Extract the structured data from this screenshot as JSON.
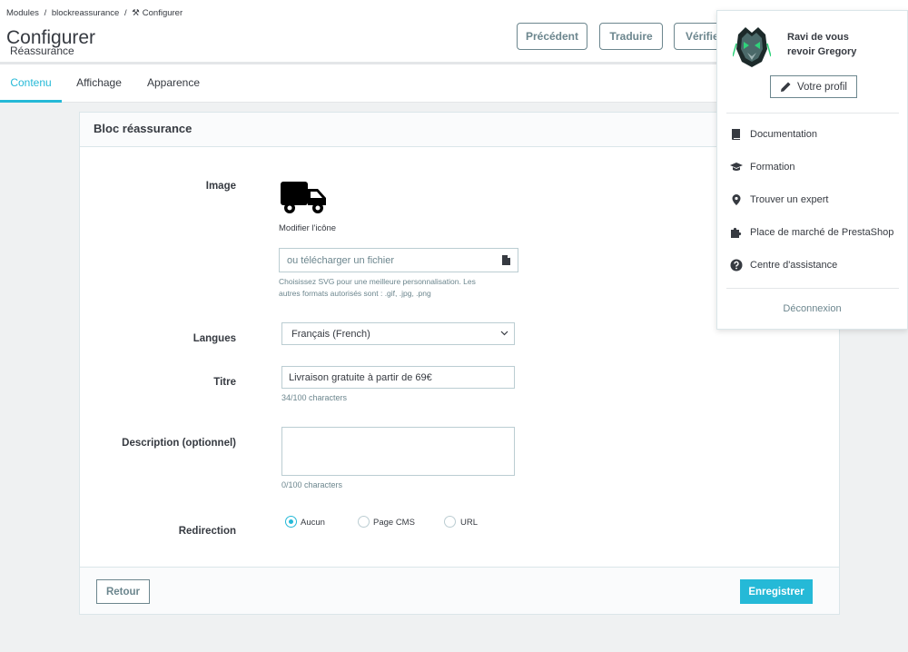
{
  "breadcrumb": [
    "Modules",
    "/",
    "blockreassurance",
    "/",
    "Configurer"
  ],
  "header": {
    "title": "Configurer",
    "subtitle": "Réassurance",
    "buttons": {
      "previous": "Précédent",
      "translate": "Traduire",
      "check": "Vérifie"
    }
  },
  "tabs": [
    "Contenu",
    "Affichage",
    "Apparence"
  ],
  "card": {
    "title": "Bloc réassurance",
    "labels": {
      "image": "Image",
      "languages": "Langues",
      "title": "Titre",
      "description": "Description (optionnel)",
      "redirection": "Redirection"
    },
    "image": {
      "icon": "truck-icon",
      "caption": "Modifier l'icône",
      "upload_placeholder": "ou télécharger un fichier",
      "help_line1": "Choisissez SVG pour une meilleure personnalisation. Les",
      "help_line2": "autres formats autorisés sont : .gif, .jpg, .png"
    },
    "language_value": "Français (French)",
    "title_value": "Livraison gratuite à partir de 69€",
    "title_counter": "34/100 characters",
    "description_value": "",
    "description_counter": "0/100 characters",
    "redirection": {
      "options": [
        "Aucun",
        "Page CMS",
        "URL"
      ],
      "selected": "Aucun"
    },
    "footer": {
      "back": "Retour",
      "save": "Enregistrer"
    }
  },
  "profile": {
    "greeting_line1": "Ravi de vous",
    "greeting_line2": "revoir Gregory",
    "edit_button": "Votre profil",
    "items": [
      {
        "label": "Documentation",
        "icon": "book-icon"
      },
      {
        "label": "Formation",
        "icon": "graduation-cap-icon"
      },
      {
        "label": "Trouver un expert",
        "icon": "location-pin-icon"
      },
      {
        "label": "Place de marché de PrestaShop",
        "icon": "puzzle-icon"
      },
      {
        "label": "Centre d'assistance",
        "icon": "help-circle-icon"
      }
    ],
    "logout": "Déconnexion"
  },
  "colors": {
    "accent": "#25b9d7",
    "text": "#363a41",
    "muted": "#6c868e",
    "background": "#eff1f2"
  }
}
